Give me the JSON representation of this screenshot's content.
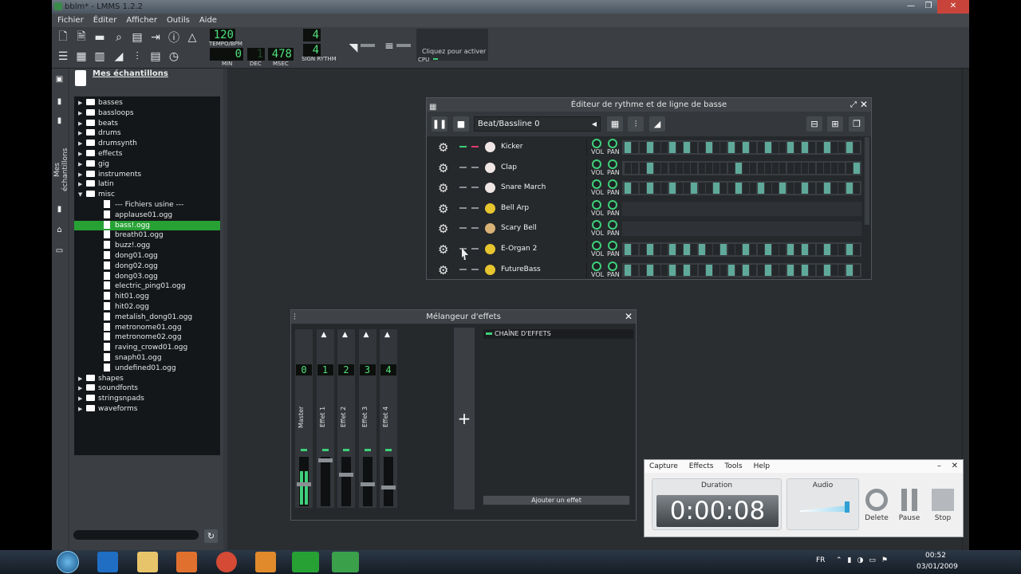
{
  "window": {
    "title": "bblm* - LMMS 1.2.2",
    "minimize": "—",
    "maximize": "❐",
    "close": "✕"
  },
  "menu": [
    "Fichier",
    "Éditer",
    "Afficher",
    "Outils",
    "Aide"
  ],
  "toolbar": {
    "tempo_value": "120",
    "tempo_label": "TEMPO/BPM",
    "time_min": "0",
    "time_dec": "1",
    "time_msec": "478",
    "min_label": "MIN",
    "dec_label": "DEC",
    "msec_label": "MSEC",
    "sig_top": "4",
    "sig_bottom": "4",
    "sig_label": "SIGN RYTHM",
    "cpu_hint": "Cliquez pour activer",
    "cpu_label": "CPU"
  },
  "sidebar": {
    "tab_label": "Mes échantillons"
  },
  "browser": {
    "title": "Mes échantillons",
    "items": [
      {
        "label": "basses",
        "kind": "folder",
        "indent": 0
      },
      {
        "label": "bassloops",
        "kind": "folder",
        "indent": 0
      },
      {
        "label": "beats",
        "kind": "folder",
        "indent": 0
      },
      {
        "label": "drums",
        "kind": "folder",
        "indent": 0
      },
      {
        "label": "drumsynth",
        "kind": "folder",
        "indent": 0
      },
      {
        "label": "effects",
        "kind": "folder",
        "indent": 0
      },
      {
        "label": "gig",
        "kind": "folder",
        "indent": 0
      },
      {
        "label": "instruments",
        "kind": "folder",
        "indent": 0
      },
      {
        "label": "latin",
        "kind": "folder",
        "indent": 0
      },
      {
        "label": "misc",
        "kind": "folder-open",
        "indent": 0
      },
      {
        "label": "--- Fichiers usine ---",
        "kind": "file",
        "indent": 1
      },
      {
        "label": "applause01.ogg",
        "kind": "file",
        "indent": 1
      },
      {
        "label": "bass!.ogg",
        "kind": "file",
        "indent": 1,
        "selected": true
      },
      {
        "label": "breath01.ogg",
        "kind": "file",
        "indent": 1
      },
      {
        "label": "buzz!.ogg",
        "kind": "file",
        "indent": 1
      },
      {
        "label": "dong01.ogg",
        "kind": "file",
        "indent": 1
      },
      {
        "label": "dong02.ogg",
        "kind": "file",
        "indent": 1
      },
      {
        "label": "dong03.ogg",
        "kind": "file",
        "indent": 1
      },
      {
        "label": "electric_ping01.ogg",
        "kind": "file",
        "indent": 1
      },
      {
        "label": "hit01.ogg",
        "kind": "file",
        "indent": 1
      },
      {
        "label": "hit02.ogg",
        "kind": "file",
        "indent": 1
      },
      {
        "label": "metalish_dong01.ogg",
        "kind": "file",
        "indent": 1
      },
      {
        "label": "metronome01.ogg",
        "kind": "file",
        "indent": 1
      },
      {
        "label": "metronome02.ogg",
        "kind": "file",
        "indent": 1
      },
      {
        "label": "raving_crowd01.ogg",
        "kind": "file",
        "indent": 1
      },
      {
        "label": "snaph01.ogg",
        "kind": "file",
        "indent": 1
      },
      {
        "label": "undefined01.ogg",
        "kind": "file",
        "indent": 1
      },
      {
        "label": "shapes",
        "kind": "folder",
        "indent": 0
      },
      {
        "label": "soundfonts",
        "kind": "folder",
        "indent": 0
      },
      {
        "label": "stringsnpads",
        "kind": "folder",
        "indent": 0
      },
      {
        "label": "waveforms",
        "kind": "folder",
        "indent": 0
      }
    ]
  },
  "beat_editor": {
    "title": "Éditeur de rythme et de ligne de basse",
    "pattern": "Beat/Bassline 0",
    "vol_label": "VOL",
    "pan_label": "PAN",
    "tracks": [
      {
        "name": "Kicker",
        "icon": "drum",
        "muted": true,
        "solo": true,
        "steps": [
          1,
          0,
          0,
          1,
          0,
          0,
          1,
          0,
          1,
          0,
          0,
          1,
          0,
          0,
          1,
          0,
          1,
          0,
          0,
          1,
          0,
          0,
          1,
          0,
          1,
          0,
          0,
          1,
          0,
          0,
          1,
          0
        ]
      },
      {
        "name": "Clap",
        "icon": "drum",
        "muted": false,
        "solo": false,
        "steps": [
          0,
          0,
          0,
          1,
          0,
          0,
          0,
          0,
          0,
          0,
          0,
          0,
          0,
          0,
          0,
          1,
          0,
          0,
          0,
          0,
          0,
          0,
          0,
          0,
          0,
          0,
          0,
          0,
          0,
          0,
          0,
          1
        ]
      },
      {
        "name": "Snare March",
        "icon": "drum",
        "muted": false,
        "solo": false,
        "steps": [
          1,
          0,
          0,
          1,
          0,
          0,
          1,
          0,
          0,
          1,
          0,
          0,
          1,
          0,
          0,
          1,
          0,
          0,
          1,
          0,
          0,
          1,
          0,
          0,
          1,
          0,
          0,
          1,
          0,
          0,
          1,
          0
        ]
      },
      {
        "name": "Bell Arp",
        "icon": "synth",
        "muted": false,
        "solo": false,
        "steps": []
      },
      {
        "name": "Scary Bell",
        "icon": "bell",
        "muted": false,
        "solo": false,
        "steps": []
      },
      {
        "name": "E-Organ 2",
        "icon": "synth",
        "muted": false,
        "solo": false,
        "steps": [
          1,
          0,
          0,
          1,
          0,
          0,
          1,
          0,
          1,
          0,
          1,
          0,
          0,
          1,
          0,
          0,
          1,
          0,
          0,
          1,
          0,
          0,
          1,
          0,
          1,
          0,
          0,
          1,
          0,
          0,
          1,
          0
        ]
      },
      {
        "name": "FutureBass",
        "icon": "synth",
        "muted": false,
        "solo": false,
        "steps": [
          1,
          0,
          0,
          1,
          0,
          0,
          1,
          0,
          1,
          0,
          0,
          1,
          0,
          0,
          1,
          0,
          1,
          0,
          0,
          1,
          0,
          0,
          1,
          0,
          1,
          0,
          0,
          1,
          0,
          0,
          1,
          0
        ]
      }
    ]
  },
  "mixer": {
    "title": "Mélangeur d'effets",
    "channels": [
      {
        "name": "Master",
        "num": "0"
      },
      {
        "name": "Effet 1",
        "num": "1"
      },
      {
        "name": "Effet 2",
        "num": "2"
      },
      {
        "name": "Effet 3",
        "num": "3"
      },
      {
        "name": "Effet 4",
        "num": "4"
      }
    ],
    "add_channel": "+",
    "chain_label": "CHAÎNE D'EFFETS",
    "add_effect": "Ajouter un effet"
  },
  "recorder": {
    "menu": [
      "Capture",
      "Effects",
      "Tools",
      "Help"
    ],
    "duration_label": "Duration",
    "duration": "0:00:08",
    "audio_label": "Audio",
    "delete_label": "Delete",
    "pause_label": "Pause",
    "stop_label": "Stop"
  },
  "taskbar": {
    "lang": "FR",
    "time": "00:52",
    "date": "03/01/2009"
  },
  "colors": {
    "accent": "#3ed07a",
    "selection": "#27a134",
    "step_on": "#5fa99a",
    "close": "#c8443b"
  }
}
